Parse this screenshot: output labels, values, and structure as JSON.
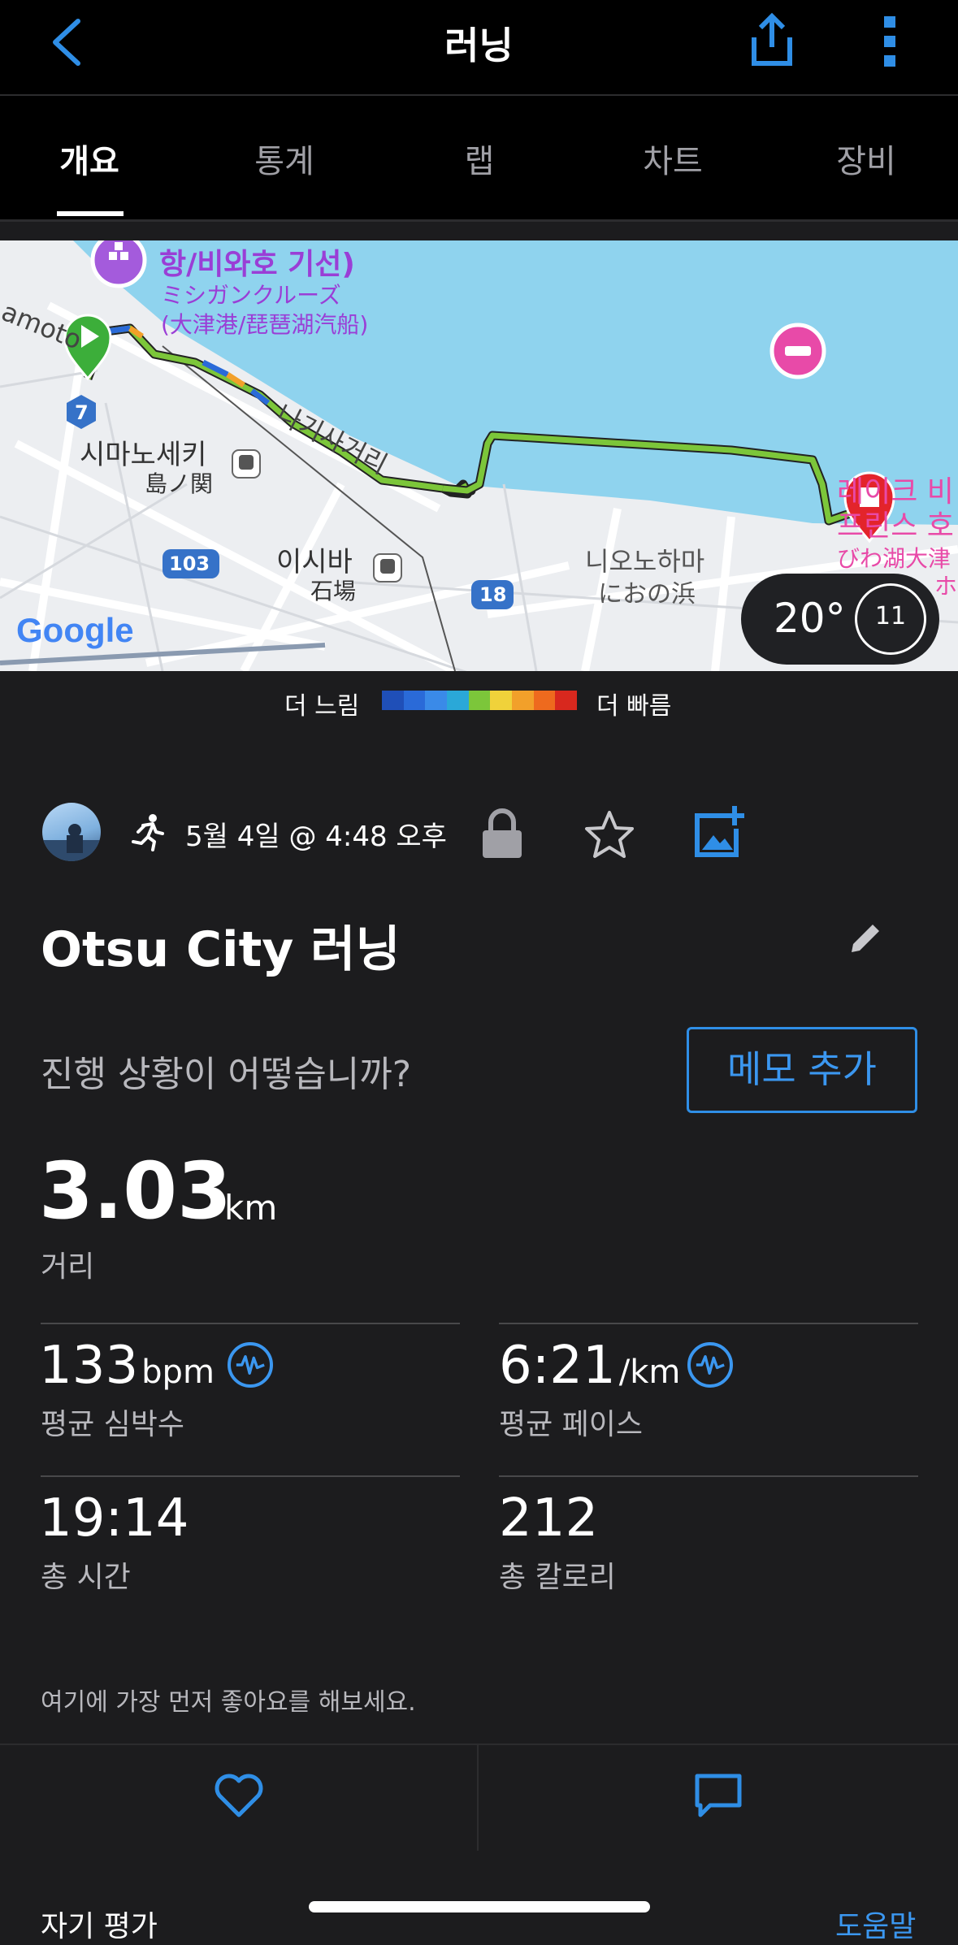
{
  "header": {
    "title": "러닝",
    "back_icon": "chevron-left-icon",
    "share_icon": "share-icon",
    "more_icon": "more-vertical-icon"
  },
  "tabs": [
    {
      "label": "개요",
      "active": true
    },
    {
      "label": "통계"
    },
    {
      "label": "랩"
    },
    {
      "label": "차트"
    },
    {
      "label": "장비"
    }
  ],
  "map": {
    "labels": {
      "ferry_ko": "항/비와호 기선)",
      "ferry_jp1": "ミシガンクルーズ",
      "ferry_jp2": "(大津港/琵琶湖汽船)",
      "street_left": "amoto",
      "street_main": "나기사거리",
      "station1_ko": "시마노세키",
      "station1_jp": "島ノ関",
      "station2_ko": "이시바",
      "station2_jp": "石場",
      "area_ko": "니오노하마",
      "area_jp": "におの浜",
      "hotel_ko1": "레이크 비",
      "hotel_ko2": "프린스 호",
      "hotel_jp1": "びわ湖大津",
      "hotel_jp2": "ホ",
      "route_7": "7",
      "route_103": "103",
      "route_18": "18",
      "google": "Google"
    },
    "weather": {
      "temp": "20°",
      "wind": "11"
    }
  },
  "legend": {
    "slow": "더 느림",
    "fast": "더 빠름",
    "colors": [
      "#1f4fb8",
      "#2a6ad8",
      "#3a8ae8",
      "#2aa8d8",
      "#7cc63a",
      "#f0d23a",
      "#f2a02a",
      "#ee6a1e",
      "#d8281e"
    ]
  },
  "activity": {
    "date": "5월 4일 @ 4:48 오후",
    "title": "Otsu City 러닝",
    "prompt": "진행 상황이 어떻습니까?",
    "memo_button": "메모 추가",
    "distance": {
      "value": "3.03",
      "unit": "km",
      "label": "거리"
    },
    "stats": [
      {
        "value": "133",
        "unit": "bpm",
        "label": "평균 심박수"
      },
      {
        "value": "6:21",
        "unit": "/km",
        "label": "평균 페이스"
      },
      {
        "value": "19:14",
        "unit": "",
        "label": "총 시간"
      },
      {
        "value": "212",
        "unit": "",
        "label": "총 칼로리"
      }
    ],
    "like_prompt": "여기에 가장 먼저 좋아요를 해보세요."
  },
  "footer": {
    "self_eval": "자기 평가",
    "help": "도움말"
  },
  "colors": {
    "accent": "#2f8ee6",
    "background": "#1c1c1e",
    "header": "#000000",
    "water": "#8fd3ee",
    "route": "#7cc63a"
  }
}
